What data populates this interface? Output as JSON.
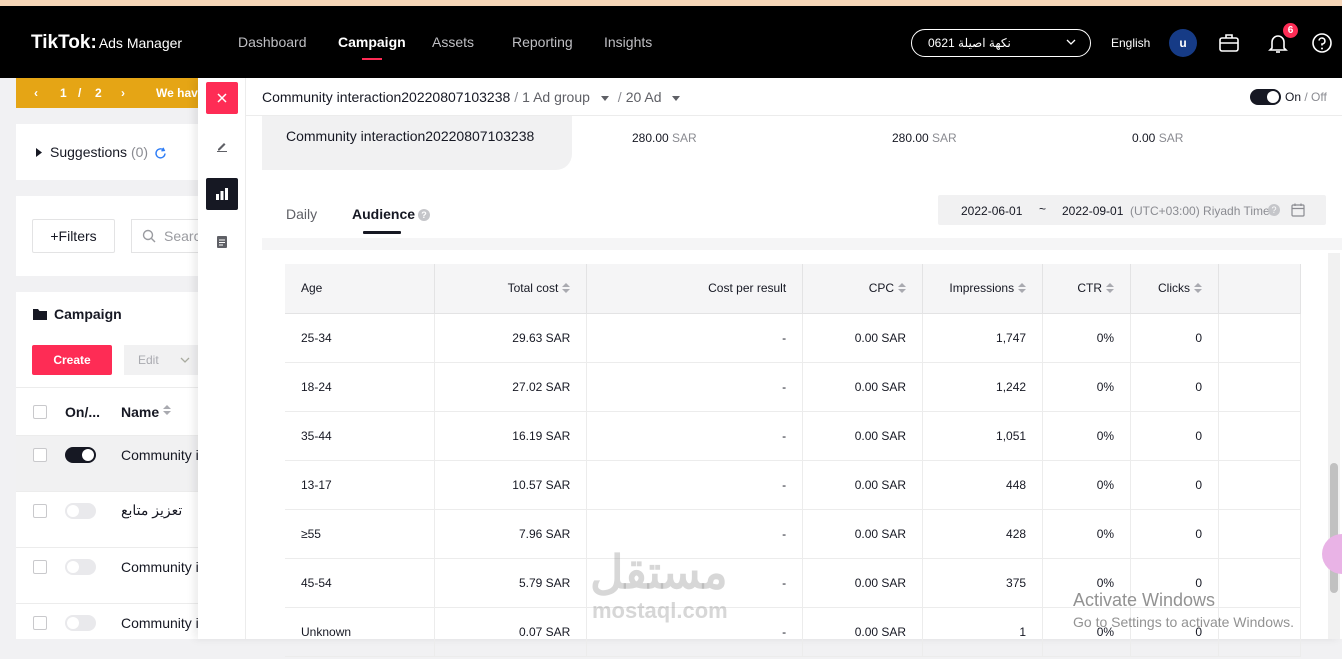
{
  "header": {
    "logo": "TikTok:",
    "logo_sub": "Ads Manager",
    "nav": [
      "Dashboard",
      "Campaign",
      "Assets",
      "Reporting",
      "Insights"
    ],
    "active_nav": "Campaign",
    "account": "0621 نكهة اصيلة",
    "language": "English",
    "avatar_letter": "u",
    "notification_count": "6"
  },
  "banner": {
    "page": "1",
    "sep": "/",
    "total": "2",
    "text": "We have"
  },
  "left": {
    "suggestions_label": "Suggestions",
    "suggestions_count": "(0)",
    "filters_label": "Filters",
    "search_placeholder": "Search",
    "campaign_title": "Campaign",
    "create_label": "Create",
    "edit_label": "Edit",
    "col_onoff": "On/...",
    "col_name": "Name",
    "rows": [
      {
        "name": "Community i",
        "on": true
      },
      {
        "name": "تعزيز متابع",
        "on": false
      },
      {
        "name": "Community i",
        "on": false
      },
      {
        "name": "Community i",
        "on": false
      }
    ]
  },
  "panel": {
    "breadcrumb": {
      "campaign": "Community interaction20220807103238",
      "adgroup": "1 Ad group",
      "ad": "20 Ad"
    },
    "onoff_on": "On",
    "onoff_sep": "/",
    "onoff_off": "Off",
    "summary": {
      "name": "Community interaction20220807103238",
      "values": [
        {
          "amount": "280.00",
          "unit": "SAR"
        },
        {
          "amount": "280.00",
          "unit": "SAR"
        },
        {
          "amount": "0.00",
          "unit": "SAR"
        }
      ]
    },
    "tabs": [
      "Daily",
      "Audience"
    ],
    "active_tab": "Audience",
    "date": {
      "start": "2022-06-01",
      "sep": "~",
      "end": "2022-09-01",
      "tz": "(UTC+03:00) Riyadh Time"
    },
    "table": {
      "columns": [
        "Age",
        "Total cost",
        "Cost per result",
        "CPC",
        "Impressions",
        "CTR",
        "Clicks"
      ],
      "rows": [
        [
          "25-34",
          "29.63 SAR",
          "-",
          "0.00 SAR",
          "1,747",
          "0%",
          "0"
        ],
        [
          "18-24",
          "27.02 SAR",
          "-",
          "0.00 SAR",
          "1,242",
          "0%",
          "0"
        ],
        [
          "35-44",
          "16.19 SAR",
          "-",
          "0.00 SAR",
          "1,051",
          "0%",
          "0"
        ],
        [
          "13-17",
          "10.57 SAR",
          "-",
          "0.00 SAR",
          "448",
          "0%",
          "0"
        ],
        [
          "≥55",
          "7.96 SAR",
          "-",
          "0.00 SAR",
          "428",
          "0%",
          "0"
        ],
        [
          "45-54",
          "5.79 SAR",
          "-",
          "0.00 SAR",
          "375",
          "0%",
          "0"
        ],
        [
          "Unknown",
          "0.07 SAR",
          "-",
          "0.00 SAR",
          "1",
          "0%",
          "0"
        ]
      ]
    }
  },
  "overlay": {
    "watermark": "مستقل",
    "watermark_sub": "mostaql.com",
    "activate_title": "Activate Windows",
    "activate_sub": "Go to Settings to activate Windows."
  },
  "colors": {
    "brand": "#fe2c55",
    "banner": "#e5a515",
    "dark": "#161823"
  }
}
